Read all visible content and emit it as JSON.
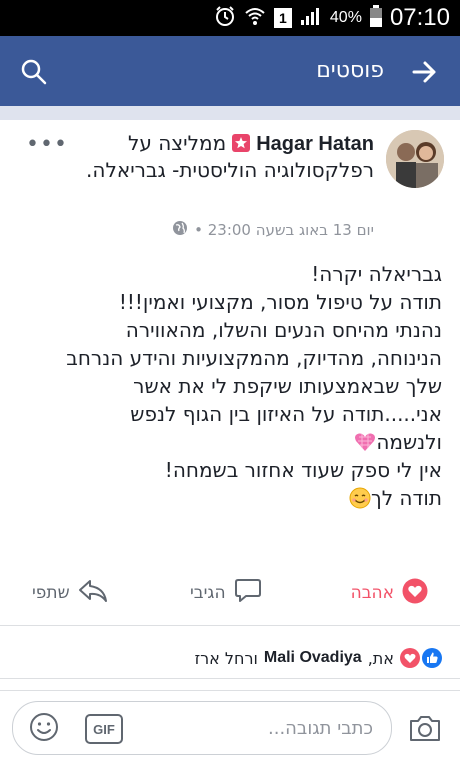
{
  "status_bar": {
    "battery_text": "40%",
    "sim_label": "1",
    "time": "07:10"
  },
  "app_bar": {
    "title": "פוסטים"
  },
  "post": {
    "author": "Hagar Hatan",
    "action_text": "ממליצה על",
    "target_page": "רפלקסולוגיה הוליסטית- גבריאלה.",
    "timestamp": "יום 13 באוג בשעה 23:00 •",
    "body_lines": [
      "גבריאלה יקרה!",
      "תודה על טיפול מסור, מקצועי ואמין!!!",
      "נהנתי מהיחס הנעים והשלו, מהאווירה",
      "הנינוחה, מהדיוק, מהמקצועיות והידע הנרחב",
      "שלך שבאמצעותו שיקפת לי את אשר",
      "אני.....תודה על האיזון בין הגוף לנפש",
      "ולנשמה",
      "אין לי ספק שעוד אחזור בשמחה!",
      "תודה לך"
    ]
  },
  "actions": {
    "love": "אהבה",
    "comment": "הגיבי",
    "share": "שתפי"
  },
  "reactions": {
    "names_prefix": "את,",
    "bold_name": "Mali Ovadiya",
    "suffix": "ורחל ארז"
  },
  "composer": {
    "placeholder": "כתבי תגובה...",
    "gif_label": "GIF"
  },
  "colors": {
    "brand": "#3b5998",
    "love": "#f25268",
    "like": "#1877f2"
  }
}
